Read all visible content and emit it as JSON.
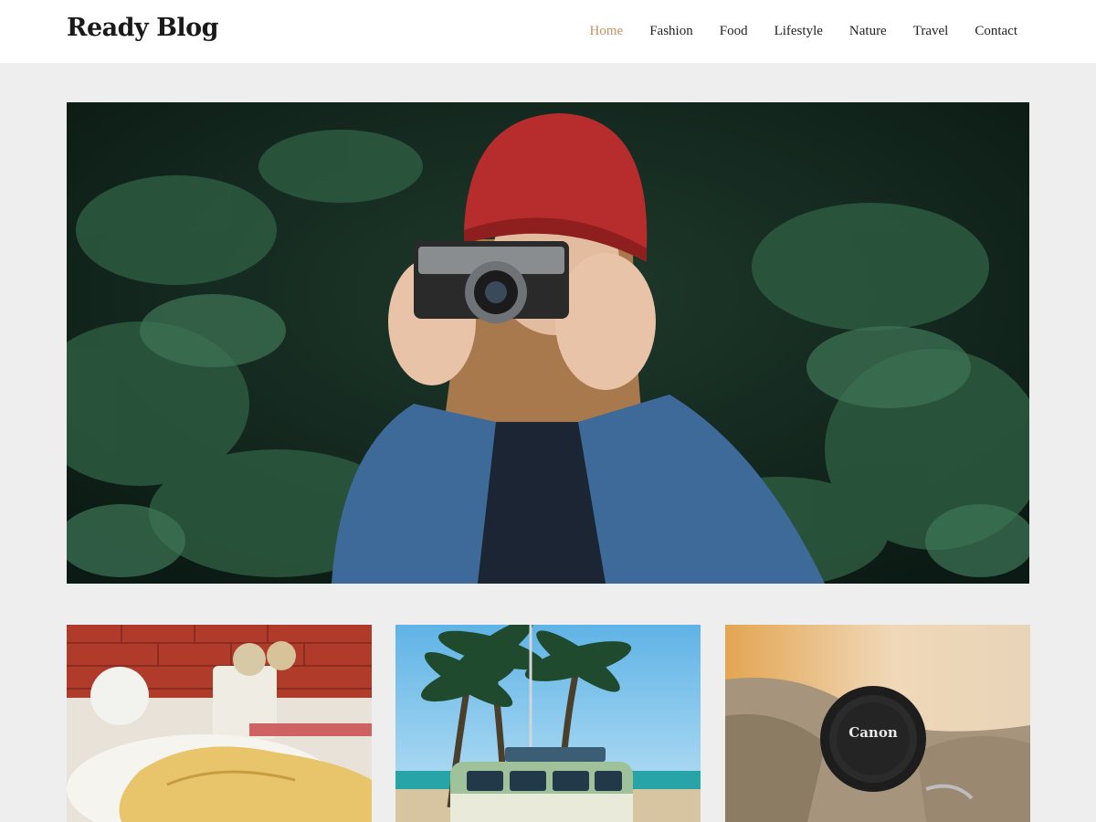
{
  "header": {
    "site_title": "Ready Blog",
    "nav": [
      {
        "label": "Home",
        "active": true
      },
      {
        "label": "Fashion",
        "active": false
      },
      {
        "label": "Food",
        "active": false
      },
      {
        "label": "Lifestyle",
        "active": false
      },
      {
        "label": "Nature",
        "active": false
      },
      {
        "label": "Travel",
        "active": false
      },
      {
        "label": "Contact",
        "active": false
      }
    ]
  },
  "colors": {
    "page_background": "#eeeeee",
    "header_background": "#ffffff",
    "nav_active": "#c98f62",
    "nav_text": "#222222",
    "title_text": "#1a1a1a"
  },
  "hero": {
    "image": "woman-with-camera-photo"
  },
  "posts": [
    {
      "image": "pancakes-breakfast-photo",
      "camera_brand": ""
    },
    {
      "image": "beach-van-palm-trees-photo",
      "camera_brand": ""
    },
    {
      "image": "camera-lens-cap-photo",
      "camera_brand": "Canon"
    }
  ]
}
